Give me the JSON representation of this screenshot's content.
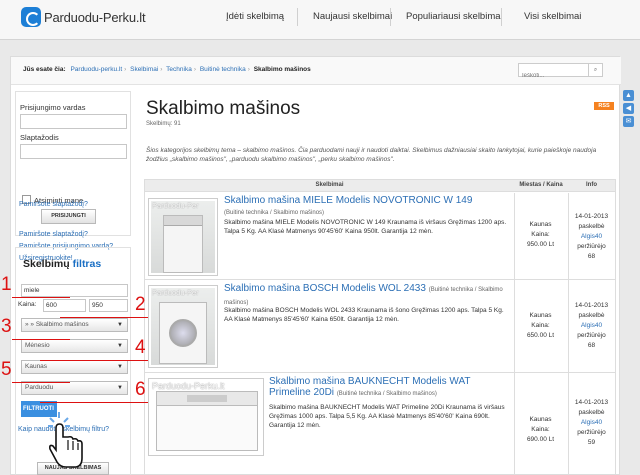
{
  "brand": {
    "name": "Parduodu-Perku.lt"
  },
  "nav": [
    {
      "label": "Įdėti skelbimą"
    },
    {
      "label": "Naujausi skelbimai"
    },
    {
      "label": "Populiariausi skelbimai"
    },
    {
      "label": "Visi skelbimai"
    }
  ],
  "breadcrumb": {
    "prefix": "Jūs esate čia:",
    "items": [
      "Parduodu-perku.lt",
      "Skelbimai",
      "Technika",
      "Buitinė technika"
    ],
    "current": "Skalbimo mašinos"
  },
  "crumb_search": {
    "placeholder": "Ieškoti..."
  },
  "login": {
    "username_label": "Prisijungimo vardas",
    "password_label": "Slaptažodis",
    "remember_label": "Atsiminti mane",
    "button": "PRISIJUNGTI",
    "forgot_password": "Pamiršote slaptažodį?",
    "forgot_username": "Pamiršote prisijungimo vardą?",
    "register": "Užsiregistruokite!"
  },
  "filter": {
    "title_main": "Skelbimų",
    "title_accent": "filtras",
    "keyword": "miele",
    "price_label": "Kaina:",
    "price_min": "600",
    "price_max": "950",
    "category": "» » Skalbimo mašinos",
    "month": "Mėnesio",
    "city": "Kaunas",
    "type": "Parduodu",
    "button": "FILTRUOTI",
    "help": "Kaip naudotis skelbimų filtru?",
    "new_ads_button": "NAUJAS SKELBIMAS",
    "callouts": [
      "1",
      "2",
      "3",
      "4",
      "5",
      "6"
    ]
  },
  "page": {
    "title": "Skalbimo mašinos",
    "count": "Skelbimų: 91",
    "rss": "RSS",
    "description": "Šios kategorijos skelbimų tema – skalbimo mašinos. Čia parduodami nauji ir naudoti daiktai. Skelbimus dažniausiai skaito lankytojai, kurie paieškoje naudoja žodžius „skalbimo mašinos\", „parduodu skalbimo mašinos\", „perku skalbimo mašinos\"."
  },
  "table": {
    "headers": [
      "Skelbimai",
      "Miestas / Kaina",
      "Info"
    ],
    "rows": [
      {
        "watermark": "Parduodu-Per",
        "title": "Skalbimo mašina MIELE Modelis NOVOTRONIC W 149",
        "category": "(Buitinė technika / Skalbimo mašinos)",
        "text": "Skalbimo mašina MIELE Modelis NOVOTRONIC W 149 Kraunama iš viršaus Gręžimas 1200 aps. Talpa 5 Kg. AA Klasė Matmenys 90'45'60' Kaina 950lt. Garantija 12 mėn.",
        "city": "Kaunas",
        "price_label": "Kaina:",
        "price": "950.00 Lt",
        "date": "14-01-2013",
        "posted": "paskelbė",
        "user": "Algis40",
        "views_label": "peržiūrėjo",
        "views": "68"
      },
      {
        "watermark": "Parduodu-Per",
        "title": "Skalbimo mašina BOSCH Modelis WOL 2433",
        "category": "(Buitinė technika / Skalbimo mašinos)",
        "text": "Skalbimo mašina BOSCH Modelis WOL 2433 Kraunama iš šono Gręžimas 1200 aps. Talpa 5 Kg. AA Klasė Matmenys 85'45'60' Kaina 650lt. Garantija 12 mėn.",
        "city": "Kaunas",
        "price_label": "Kaina:",
        "price": "650.00 Lt",
        "date": "14-01-2013",
        "posted": "paskelbė",
        "user": "Algis40",
        "views_label": "peržiūrėjo",
        "views": "68"
      },
      {
        "watermark": "Parduodu-Perku.lt",
        "title": "Skalbimo mašina BAUKNECHT Modelis WAT Primeline 20Di",
        "category": "(Buitinė technika / Skalbimo mašinos)",
        "text": "Skalbimo mašina BAUKNECHT Modelis WAT Primeline 20Di Kraunama iš viršaus Gręžimas 1000 aps. Talpa 5,5 Kg. AA Klasė Matmenys 85'40'60' Kaina 690lt. Garantija 12 mėn.",
        "city": "Kaunas",
        "price_label": "Kaina:",
        "price": "690.00 Lt",
        "date": "14-01-2013",
        "posted": "paskelbė",
        "user": "Algis40",
        "views_label": "peržiūrėjo",
        "views": "59"
      }
    ]
  },
  "side_icons": [
    "up-arrow",
    "left-arrow",
    "comment"
  ],
  "colors": {
    "accent": "#2c6fb5",
    "callout": "#dd1111",
    "rss": "#f58220",
    "filter_button": "#3a8fe0"
  }
}
